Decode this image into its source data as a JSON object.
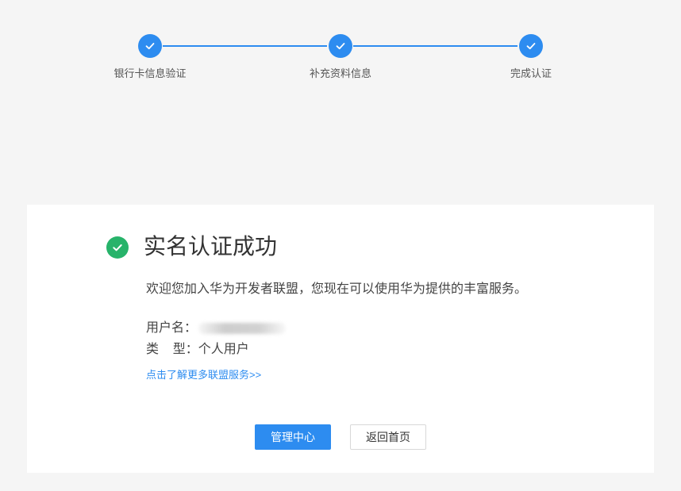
{
  "stepper": {
    "steps": [
      {
        "label": "银行卡信息验证",
        "status": "done"
      },
      {
        "label": "补充资料信息",
        "status": "done"
      },
      {
        "label": "完成认证",
        "status": "done"
      }
    ],
    "accent_color": "#2d8cf0"
  },
  "result": {
    "title": "实名认证成功",
    "welcome_text": "欢迎您加入华为开发者联盟，您现在可以使用华为提供的丰富服务。",
    "username_label": "用户名：",
    "username_value_hidden": true,
    "type_label": "类    型：",
    "type_value": "个人用户",
    "more_link": "点击了解更多联盟服务>>",
    "success_color": "#27b36a"
  },
  "actions": {
    "manage_center_label": "管理中心",
    "back_home_label": "返回首页"
  }
}
